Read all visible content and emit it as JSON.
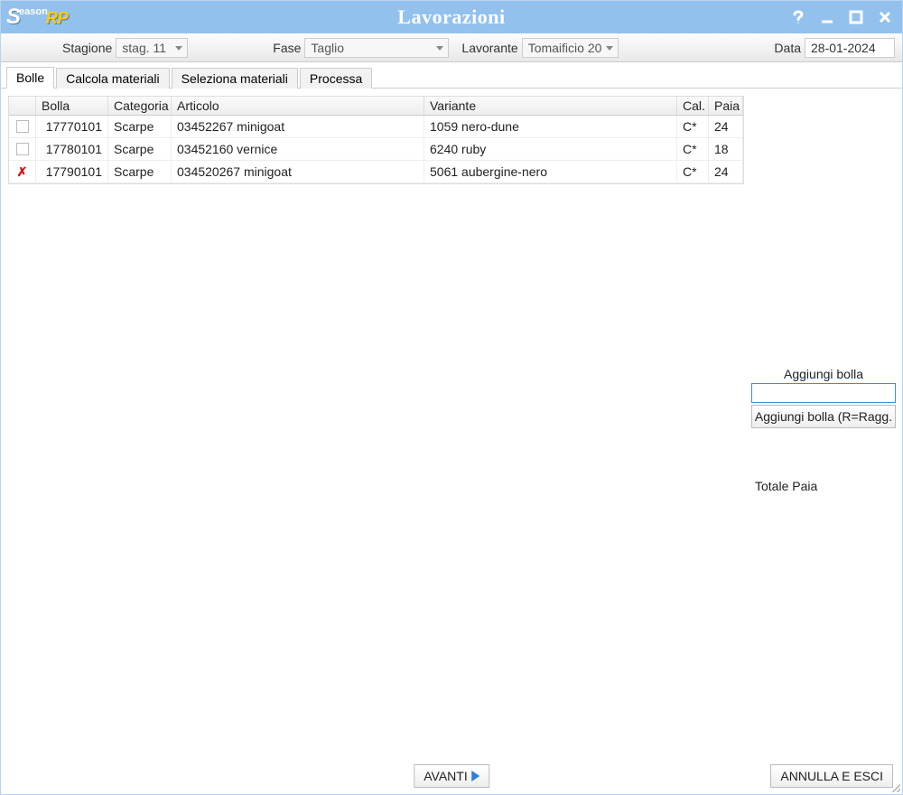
{
  "window": {
    "title": "Lavorazioni",
    "logo": {
      "s": "S",
      "sup": "eason",
      "rp": "RP"
    }
  },
  "toolbar": {
    "stagione_label": "Stagione",
    "stagione_value": "stag. 11",
    "fase_label": "Fase",
    "fase_value": "Taglio",
    "lavorante_label": "Lavorante",
    "lavorante_value": "Tomaificio 20",
    "data_label": "Data",
    "data_value": "28-01-2024"
  },
  "tabs": [
    {
      "label": "Bolle",
      "active": true
    },
    {
      "label": "Calcola materiali",
      "active": false
    },
    {
      "label": "Seleziona materiali",
      "active": false
    },
    {
      "label": "Processa",
      "active": false
    }
  ],
  "grid": {
    "headers": {
      "bolla": "Bolla",
      "categoria": "Categoria",
      "articolo": "Articolo",
      "variante": "Variante",
      "cal": "Cal.",
      "paia": "Paia"
    },
    "rows": [
      {
        "selected": false,
        "icon": "",
        "bolla": "17770101",
        "categoria": "Scarpe",
        "articolo": "03452267 minigoat",
        "variante": "1059 nero-dune",
        "cal": "C*",
        "paia": "24"
      },
      {
        "selected": false,
        "icon": "",
        "bolla": "17780101",
        "categoria": "Scarpe",
        "articolo": "03452160 vernice",
        "variante": "6240 ruby",
        "cal": "C*",
        "paia": "18"
      },
      {
        "selected": false,
        "icon": "x",
        "bolla": "17790101",
        "categoria": "Scarpe",
        "articolo": "034520267 minigoat",
        "variante": "5061 aubergine-nero",
        "cal": "C*",
        "paia": "24"
      }
    ]
  },
  "side": {
    "add_label": "Aggiungi bolla",
    "add_value": "",
    "add_button": "Aggiungi bolla (R=Ragg.",
    "total_label": "Totale Paia"
  },
  "footer": {
    "avanti": "AVANTI",
    "annulla": "ANNULLA E ESCI"
  }
}
